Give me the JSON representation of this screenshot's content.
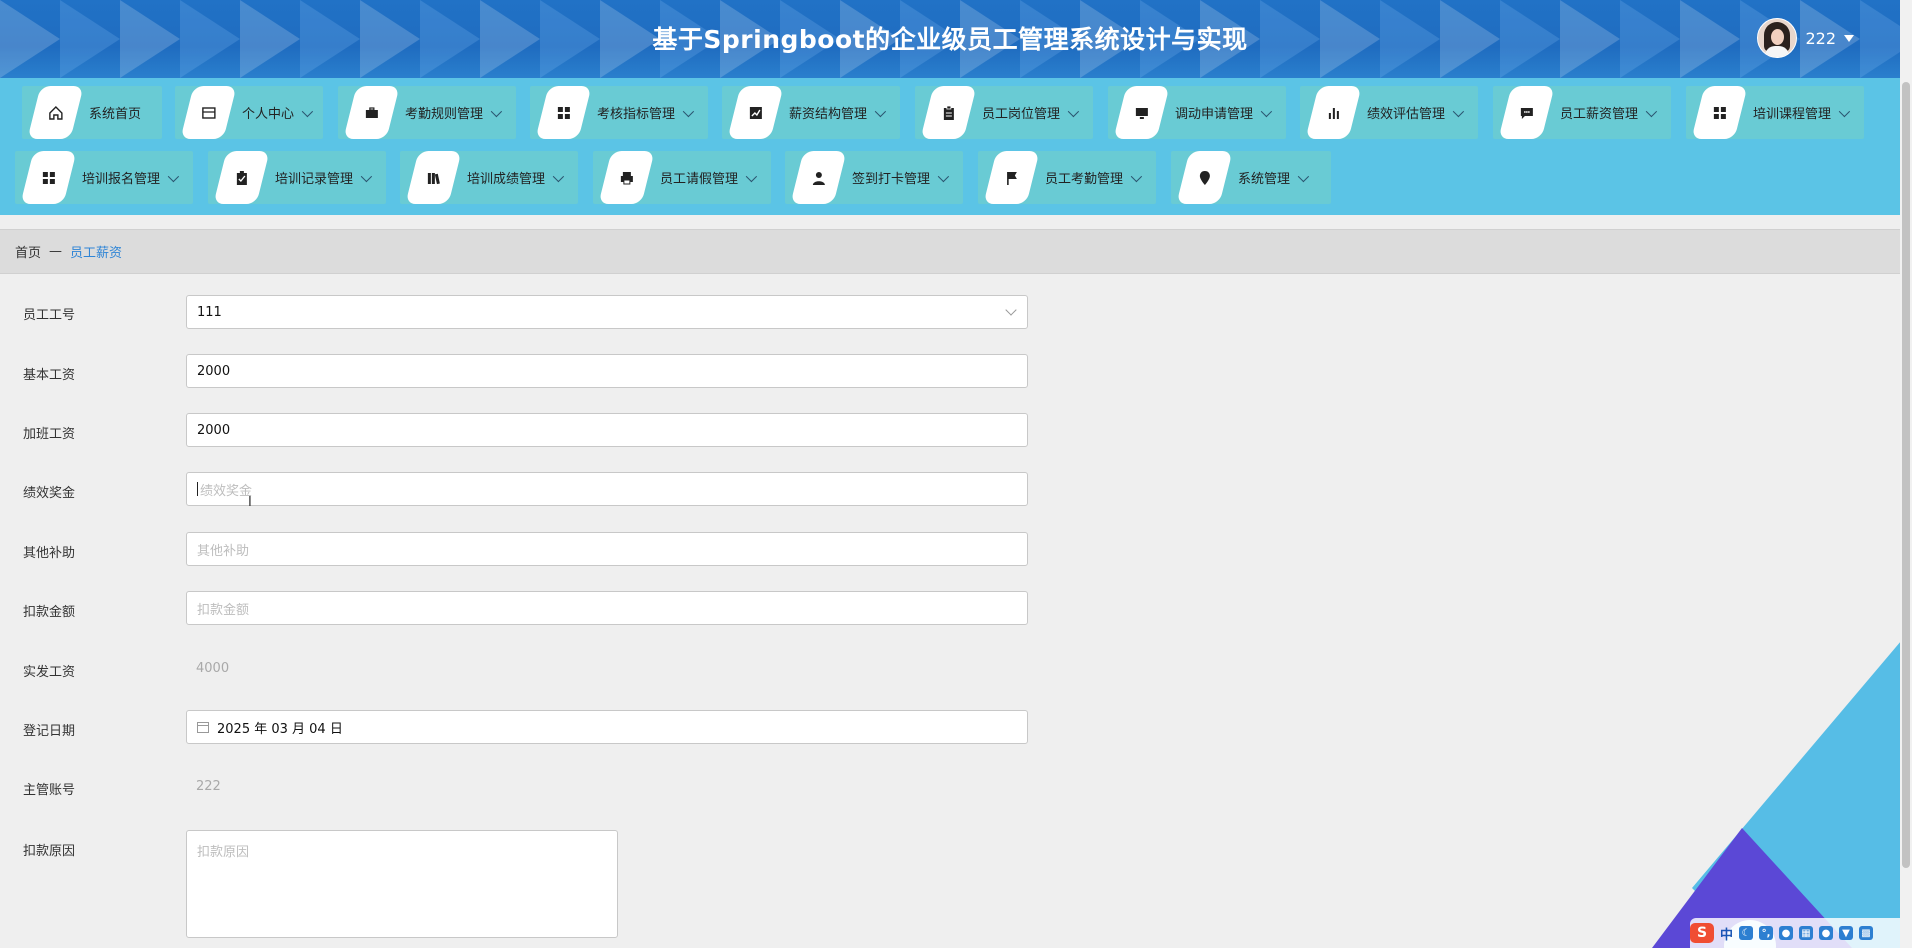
{
  "header": {
    "title": "基于Springboot的企业级员工管理系统设计与实现",
    "user": {
      "name": "222"
    }
  },
  "nav": {
    "items": [
      {
        "label": "系统首页",
        "icon": "home-icon",
        "dropdown": false
      },
      {
        "label": "个人中心",
        "icon": "card-icon",
        "dropdown": true
      },
      {
        "label": "考勤规则管理",
        "icon": "briefcase-icon",
        "dropdown": true
      },
      {
        "label": "考核指标管理",
        "icon": "grid-icon",
        "dropdown": true
      },
      {
        "label": "薪资结构管理",
        "icon": "trend-chart-icon",
        "dropdown": true
      },
      {
        "label": "员工岗位管理",
        "icon": "clipboard-icon",
        "dropdown": true
      },
      {
        "label": "调动申请管理",
        "icon": "monitor-icon",
        "dropdown": true
      },
      {
        "label": "绩效评估管理",
        "icon": "bar-chart-icon",
        "dropdown": true
      },
      {
        "label": "员工薪资管理",
        "icon": "message-icon",
        "dropdown": true
      },
      {
        "label": "培训课程管理",
        "icon": "grid-icon",
        "dropdown": true
      },
      {
        "label": "培训报名管理",
        "icon": "grid-icon",
        "dropdown": true
      },
      {
        "label": "培训记录管理",
        "icon": "clipboard-check-icon",
        "dropdown": true
      },
      {
        "label": "培训成绩管理",
        "icon": "library-icon",
        "dropdown": true
      },
      {
        "label": "员工请假管理",
        "icon": "printer-icon",
        "dropdown": true
      },
      {
        "label": "签到打卡管理",
        "icon": "person-icon",
        "dropdown": true
      },
      {
        "label": "员工考勤管理",
        "icon": "flag-icon",
        "dropdown": true
      },
      {
        "label": "系统管理",
        "icon": "pin-icon",
        "dropdown": true
      }
    ]
  },
  "breadcrumb": {
    "home": "首页",
    "separator": "—",
    "current": "员工薪资"
  },
  "form": {
    "employee_id": {
      "label": "员工工号",
      "value": "111"
    },
    "base_salary": {
      "label": "基本工资",
      "value": "2000"
    },
    "overtime_pay": {
      "label": "加班工资",
      "value": "2000"
    },
    "performance_bonus": {
      "label": "绩效奖金",
      "placeholder": "绩效奖金"
    },
    "other_allowance": {
      "label": "其他补助",
      "placeholder": "其他补助"
    },
    "deduction_amount": {
      "label": "扣款金额",
      "placeholder": "扣款金额"
    },
    "net_salary": {
      "label": "实发工资",
      "value": "4000"
    },
    "register_date": {
      "label": "登记日期",
      "value": "2025 年 03 月 04 日"
    },
    "manager_account": {
      "label": "主管账号",
      "value": "222"
    },
    "deduction_reason": {
      "label": "扣款原因",
      "placeholder": "扣款原因"
    }
  },
  "taskbar": {
    "ime_label": "中"
  },
  "colors": {
    "header_bg": "#1f6cc0",
    "nav_bg": "#5bc4e6",
    "nav_item_bg": "#69cbd4",
    "breadcrumb_active": "#2f85d6",
    "decoration_blue": "#56bde6",
    "decoration_purple": "#5b48d6"
  }
}
